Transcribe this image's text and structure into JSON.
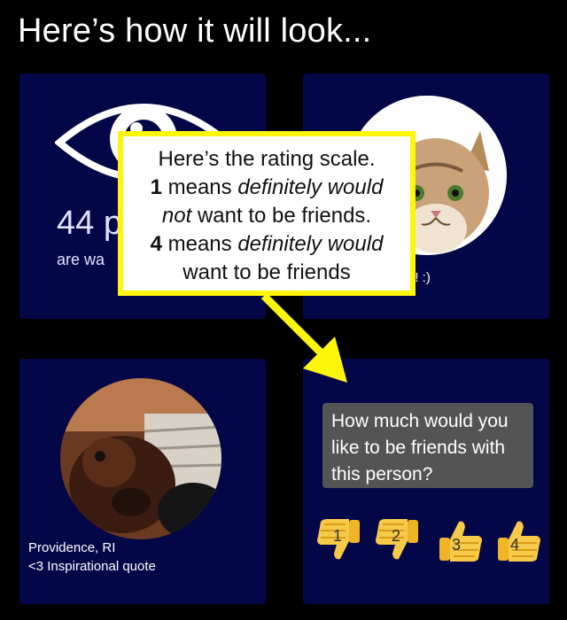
{
  "header": {
    "title": "Here’s how it will look..."
  },
  "cards": {
    "viewers": {
      "count": "44 p",
      "subtitle": "are wa"
    },
    "cat_profile": {
      "caption": "p! :)"
    },
    "dog_profile": {
      "location": "Providence, RI",
      "bio": "<3 Inspirational quote"
    },
    "question": {
      "text": "How much would you like to be friends with this person?",
      "ratings": [
        {
          "label": "1",
          "icon": "thumbs-down-icon"
        },
        {
          "label": "2",
          "icon": "thumbs-down-icon"
        },
        {
          "label": "3",
          "icon": "thumbs-up-icon"
        },
        {
          "label": "4",
          "icon": "thumbs-up-icon"
        }
      ]
    }
  },
  "callout": {
    "line1": "Here’s the rating scale.",
    "line2_num": "1",
    "line2_pre": " means ",
    "line2_italic": "definitely would",
    "line3_italic": "not",
    "line3_rest": " want to be friends.",
    "line4_num": "4",
    "line4_pre": " means ",
    "line4_italic": "definitely would",
    "line5": "want to be friends"
  },
  "colors": {
    "card_bg": "#030748",
    "callout_border": "#fef50d",
    "arrow": "#fef50d",
    "question_bg": "#545454"
  }
}
